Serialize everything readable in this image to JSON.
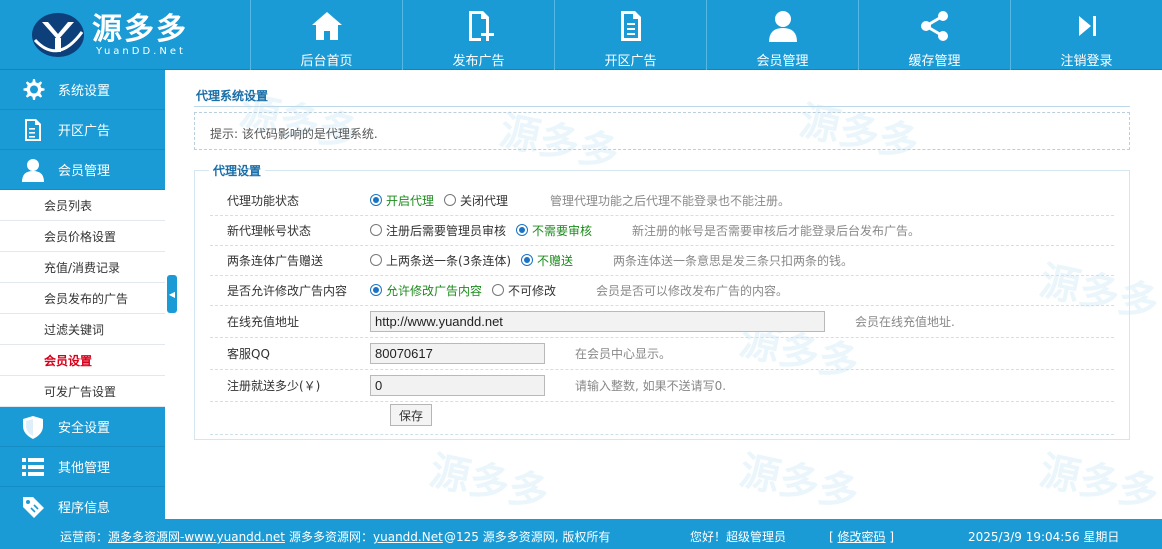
{
  "logo": {
    "cn": "源多多",
    "en": "YuanDD.Net"
  },
  "nav": [
    {
      "label": "后台首页",
      "icon": "home-icon"
    },
    {
      "label": "发布广告",
      "icon": "add-document-icon"
    },
    {
      "label": "开区广告",
      "icon": "document-icon"
    },
    {
      "label": "会员管理",
      "icon": "user-icon"
    },
    {
      "label": "缓存管理",
      "icon": "share-icon"
    },
    {
      "label": "注销登录",
      "icon": "logout-icon"
    }
  ],
  "sidebar": {
    "groups": [
      {
        "label": "系统设置",
        "icon": "gear-icon"
      },
      {
        "label": "开区广告",
        "icon": "document-icon"
      },
      {
        "label": "会员管理",
        "icon": "user-icon"
      }
    ],
    "sub_items": [
      {
        "label": "会员列表"
      },
      {
        "label": "会员价格设置"
      },
      {
        "label": "充值/消费记录"
      },
      {
        "label": "会员发布的广告"
      },
      {
        "label": "过滤关键词"
      },
      {
        "label": "会员设置"
      },
      {
        "label": "可发广告设置"
      }
    ],
    "bottom_groups": [
      {
        "label": "安全设置",
        "icon": "shield-icon"
      },
      {
        "label": "其他管理",
        "icon": "list-icon"
      },
      {
        "label": "程序信息",
        "icon": "tag-icon"
      }
    ],
    "collapse_glyph": "◀"
  },
  "main": {
    "title": "代理系统设置",
    "tip": "提示: 该代码影响的是代理系统.",
    "section_title": "代理设置",
    "rows": [
      {
        "label": "代理功能状态",
        "options": [
          {
            "label": "开启代理",
            "checked": true
          },
          {
            "label": "关闭代理",
            "checked": false
          }
        ],
        "hint": "管理代理功能之后代理不能登录也不能注册。"
      },
      {
        "label": "新代理帐号状态",
        "options": [
          {
            "label": "注册后需要管理员审核",
            "checked": false
          },
          {
            "label": "不需要审核",
            "checked": true
          }
        ],
        "hint": "新注册的帐号是否需要审核后才能登录后台发布广告。"
      },
      {
        "label": "两条连体广告赠送",
        "options": [
          {
            "label": "上两条送一条(3条连体)",
            "checked": false
          },
          {
            "label": "不赠送",
            "checked": true
          }
        ],
        "hint": "两条连体送一条意思是发三条只扣两条的钱。"
      },
      {
        "label": "是否允许修改广告内容",
        "options": [
          {
            "label": "允许修改广告内容",
            "checked": true
          },
          {
            "label": "不可修改",
            "checked": false
          }
        ],
        "hint": "会员是否可以修改发布广告的内容。"
      }
    ],
    "inputs": [
      {
        "label": "在线充值地址",
        "value": "http://www.yuandd.net",
        "hint": "会员在线充值地址."
      },
      {
        "label": "客服QQ",
        "value": "80070617",
        "hint": "在会员中心显示。"
      },
      {
        "label": "注册就送多少(￥)",
        "value": "0",
        "hint": "请输入整数, 如果不送请写0."
      }
    ],
    "save_label": "保存"
  },
  "watermark_text": "源多多",
  "footer": {
    "operator_prefix": "运营商：",
    "operator_link": "源多多资源网-www.yuandd.net",
    "site_prefix": "源多多资源网：",
    "site_link": "yuandd.Net",
    "copyright": "@125 源多多资源网, 版权所有",
    "greeting": "您好！超级管理员",
    "change_pwd_open": "[",
    "change_pwd": "修改密码",
    "change_pwd_close": "]",
    "datetime": "2025/3/9 19:04:56 星期日"
  },
  "colors": {
    "primary": "#1a9bd6",
    "active": "#d9001b",
    "checked": "#1d8b1d"
  }
}
